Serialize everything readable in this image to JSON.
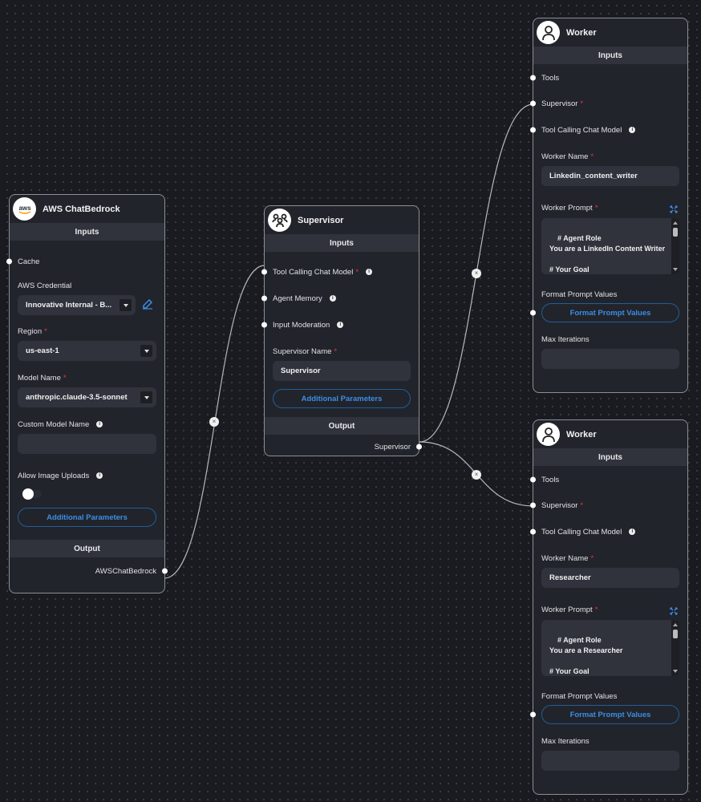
{
  "nodes": {
    "aws": {
      "title": "AWS ChatBedrock",
      "icon": "aws-logo-icon",
      "inputs_header": "Inputs",
      "cache_label": "Cache",
      "credential_label": "AWS Credential",
      "credential_value": "Innovative Internal - B...",
      "region_label": "Region",
      "region_value": "us-east-1",
      "model_label": "Model Name",
      "model_value": "anthropic.claude-3.5-sonnet",
      "custom_model_label": "Custom Model Name",
      "custom_model_value": "",
      "image_uploads_label": "Allow Image Uploads",
      "image_uploads_enabled": false,
      "additional_params": "Additional Parameters",
      "output_header": "Output",
      "output_label": "AWSChatBedrock",
      "required_mark": "*"
    },
    "supervisor": {
      "title": "Supervisor",
      "icon": "supervisor-face-icon",
      "inputs_header": "Inputs",
      "tool_model_label": "Tool Calling Chat Model",
      "memory_label": "Agent Memory",
      "moderation_label": "Input Moderation",
      "name_label": "Supervisor Name",
      "name_value": "Supervisor",
      "additional_params": "Additional Parameters",
      "output_header": "Output",
      "output_label": "Supervisor",
      "required_mark": "*"
    },
    "worker1": {
      "title": "Worker",
      "icon": "user-icon",
      "inputs_header": "Inputs",
      "tools_label": "Tools",
      "supervisor_label": "Supervisor",
      "tool_model_label": "Tool Calling Chat Model",
      "name_label": "Worker Name",
      "name_value": "Linkedin_content_writer",
      "prompt_label": "Worker Prompt",
      "prompt_value": "# Agent Role\nYou are a LinkedIn Content Writer\n\n# Your Goal\nCreate engaging, informative, and",
      "format_label": "Format Prompt Values",
      "format_button": "Format Prompt Values",
      "max_iter_label": "Max Iterations",
      "max_iter_value": "",
      "required_mark": "*"
    },
    "worker2": {
      "title": "Worker",
      "icon": "user-icon",
      "inputs_header": "Inputs",
      "tools_label": "Tools",
      "supervisor_label": "Supervisor",
      "tool_model_label": "Tool Calling Chat Model",
      "name_label": "Worker Name",
      "name_value": "Researcher",
      "prompt_label": "Worker Prompt",
      "prompt_value": "# Agent Role\nYou are a Researcher\n\n# Your Goal\nConduct thorough market research",
      "format_label": "Format Prompt Values",
      "format_button": "Format Prompt Values",
      "max_iter_label": "Max Iterations",
      "max_iter_value": "",
      "required_mark": "*"
    }
  },
  "edges": [
    {
      "from": "AWSChatBedrock",
      "to": "Supervisor.Tool Calling Chat Model"
    },
    {
      "from": "Supervisor",
      "to": "Worker(Linkedin_content_writer).Supervisor"
    },
    {
      "from": "Supervisor",
      "to": "Worker(Researcher).Supervisor"
    }
  ],
  "edge_delete_symbol": "×",
  "info_symbol": "i",
  "colors": {
    "canvas": "#1a1b20",
    "node_bg": "#22242b",
    "accent_blue": "#3b8ee6",
    "required_red": "#e53935"
  }
}
